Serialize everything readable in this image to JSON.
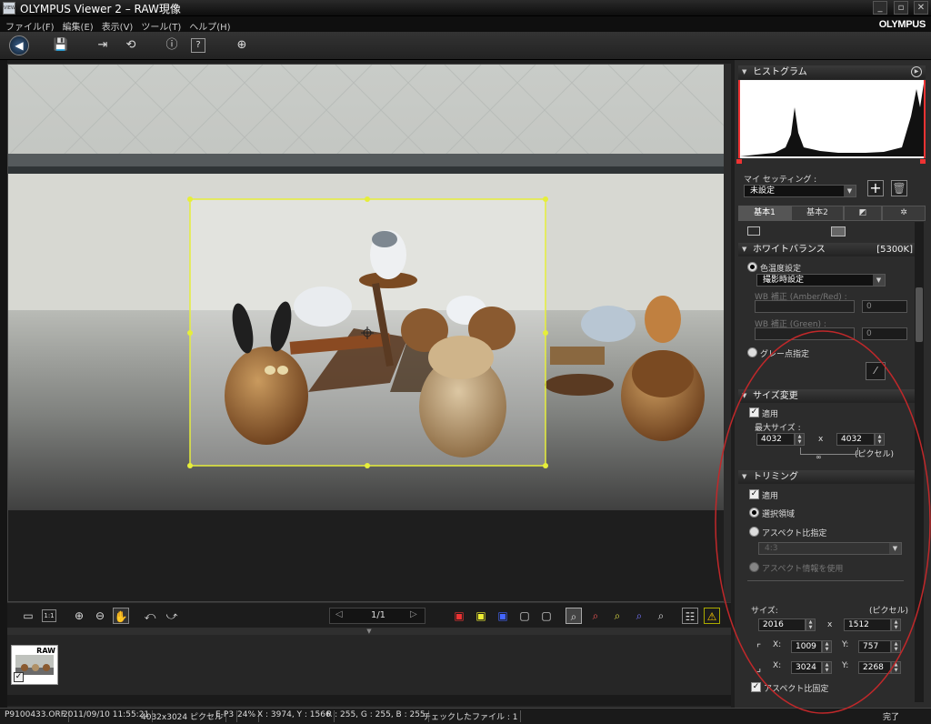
{
  "window": {
    "title": "OLYMPUS Viewer 2 – RAW現像",
    "brand": "OLYMPUS",
    "app_icon_text": "VIEW",
    "controls": {
      "minimize": "_",
      "restore": "▫",
      "close": "✕"
    }
  },
  "menu": [
    "ファイル(F)",
    "編集(E)",
    "表示(V)",
    "ツール(T)",
    "ヘルプ(H)"
  ],
  "toolbar": {
    "icons": [
      "back-icon",
      "save-icon",
      "export-icon",
      "rotate-icon",
      "info-icon",
      "help-icon",
      "web-icon"
    ]
  },
  "viewer": {
    "page": "1/1",
    "prev": "◁",
    "next": "▷"
  },
  "thumbnail": {
    "badge": "RAW",
    "check": "✓"
  },
  "status": [
    "P9100433.ORF",
    "2011/09/10 11:55:21",
    "4032x3024 ピクセル",
    "E-P3",
    "24%",
    "X : 3974, Y : 1566",
    "R : 255, G : 255, B : 255",
    "チェックしたファイル : 1"
  ],
  "status_right": "完了",
  "panel": {
    "histogram_title": "ヒストグラム",
    "my_settings_label": "マイ セッティング :",
    "my_settings_value": "未設定",
    "tabs": [
      "基本1",
      "基本2",
      "◩",
      "✲"
    ],
    "wb": {
      "title": "ホワイトバランス",
      "badge": "[5300K]",
      "color_temp_label": "色温度設定",
      "preset": "撮影時設定",
      "amber_red_label": "WB 補正 (Amber/Red) :",
      "amber_red_value": "0",
      "green_label": "WB 補正 (Green) :",
      "green_value": "0",
      "gray_point_label": "グレー点指定"
    },
    "resize": {
      "title": "サイズ変更",
      "apply_label": "適用",
      "max_size_label": "最大サイズ :",
      "width": "4032",
      "height": "4032",
      "times": "x",
      "unit": "(ピクセル)"
    },
    "trim": {
      "title": "トリミング",
      "apply_label": "適用",
      "selection_label": "選択領域",
      "aspect_label": "アスペクト比指定",
      "aspect_value": "4:3",
      "aspect_info_label": "アスペクト情報を使用",
      "size_label": "サイズ:",
      "unit": "(ピクセル)",
      "width": "2016",
      "height": "1512",
      "times": "x",
      "x_label": "X:",
      "y_label": "Y:",
      "x1": "1009",
      "y1": "757",
      "x2": "3024",
      "y2": "2268",
      "fix_aspect_label": "アスペクト比固定"
    }
  }
}
